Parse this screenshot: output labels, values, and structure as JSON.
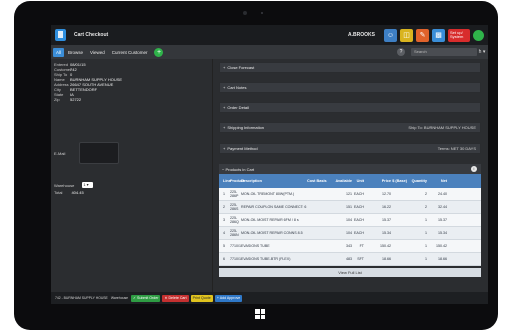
{
  "header": {
    "app_title": "Cart Checkout",
    "user_name": "A.BROOKS",
    "icons": [
      "user-icon",
      "cart-icon",
      "notes-icon",
      "document-icon",
      "setup-icon",
      "online-status-icon"
    ],
    "setup_label": "Set up/ System"
  },
  "tabs": {
    "items": [
      "All",
      "Browse",
      "Viewed",
      "Current Customer"
    ],
    "active": "All",
    "search_placeholder": "Search",
    "search_go": "h ▾"
  },
  "customer": {
    "fields": [
      {
        "label": "Entered",
        "value": "08/01/15"
      },
      {
        "label": "Customer",
        "value": "742"
      },
      {
        "label": "Ship To",
        "value": "0"
      },
      {
        "label": "Name",
        "value": "BURNHAM SUPPLY HOUSE"
      },
      {
        "label": "Address",
        "value": "26647 SOUTH AVENUE"
      },
      {
        "label": "City",
        "value": "BETTENDORF"
      },
      {
        "label": "State",
        "value": "IA"
      },
      {
        "label": "Zip",
        "value": "52722"
      }
    ],
    "email_label": "E-Mail",
    "warehouse_label": "Warehouse",
    "warehouse_value": "1 ▾",
    "total_label": "Total",
    "total_value": "404.45"
  },
  "sections": [
    {
      "label": "Close Forecast",
      "right": ""
    },
    {
      "label": "Cart Notes",
      "right": ""
    },
    {
      "label": "Order Detail",
      "right": ""
    },
    {
      "label": "Shipping Information",
      "right": "Ship To: BURNHAM SUPPLY HOUSE"
    },
    {
      "label": "Payment Method",
      "right": "Terms: NET 30 DAYS"
    }
  ],
  "products": {
    "heading": "Products in Cart",
    "columns": {
      "line": "Line",
      "product": "Product",
      "description": "Description",
      "cost": "Cost Basis",
      "available": "Available",
      "unit": "Unit",
      "price": "Price",
      "discount": "Discount",
      "disc_flag": "$ (Base)",
      "quantity": "Quantity",
      "net": "Net"
    },
    "rows": [
      {
        "line": "1",
        "product": "225-286P",
        "description": "MON-OIL TREMONT 80W(PTM.)",
        "cost": "",
        "available": "121",
        "unit": "EACH",
        "price": "12.70",
        "discount": "",
        "quantity": "2",
        "net": "24.40"
      },
      {
        "line": "2",
        "product": "225-286S",
        "description": "REPAIR COUPLON SAME CONNECT: 6",
        "cost": "",
        "available": "151",
        "unit": "EACH",
        "price": "16.22",
        "discount": "",
        "quantity": "2",
        "net": "32.44"
      },
      {
        "line": "3",
        "product": "225-286Q",
        "description": "MON-OIL MOIST REPAIR 6FM / 8 s",
        "cost": "",
        "available": "104",
        "unit": "EACH",
        "price": "15.37",
        "discount": "",
        "quantity": "1",
        "net": "15.37"
      },
      {
        "line": "4",
        "product": "225-286N",
        "description": "MON-OIL MOIST REPAIR CONNS 8.5",
        "cost": "",
        "available": "104",
        "unit": "EACH",
        "price": "15.34",
        "discount": "",
        "quantity": "1",
        "net": "15.34"
      },
      {
        "line": "5",
        "product": "7710/1",
        "description": "EVASIONS TUBE",
        "cost": "",
        "available": "343",
        "unit": "FT",
        "price": "150.42",
        "discount": "",
        "quantity": "1",
        "net": "150.42"
      },
      {
        "line": "6",
        "product": "7710/1",
        "description": "EVASIONS TUBE-BTR (FLEX)",
        "cost": "",
        "available": "483",
        "unit": "SFT",
        "price": "18.66",
        "discount": "",
        "quantity": "1",
        "net": "18.66"
      }
    ],
    "view_full": "View Full List"
  },
  "bottombar": {
    "customer_label": "742 - BURNHAM SUPPLY HOUSE",
    "warehouse_label": "Warehouse",
    "buttons": [
      {
        "label": "✓ Submit Order",
        "color": "#2e9c43"
      },
      {
        "label": "✕ Delete Cart",
        "color": "#c53030"
      },
      {
        "label": "Print Quote",
        "color": "#e0c31e"
      },
      {
        "label": "+ Add Approve",
        "color": "#2f78c8"
      }
    ]
  }
}
